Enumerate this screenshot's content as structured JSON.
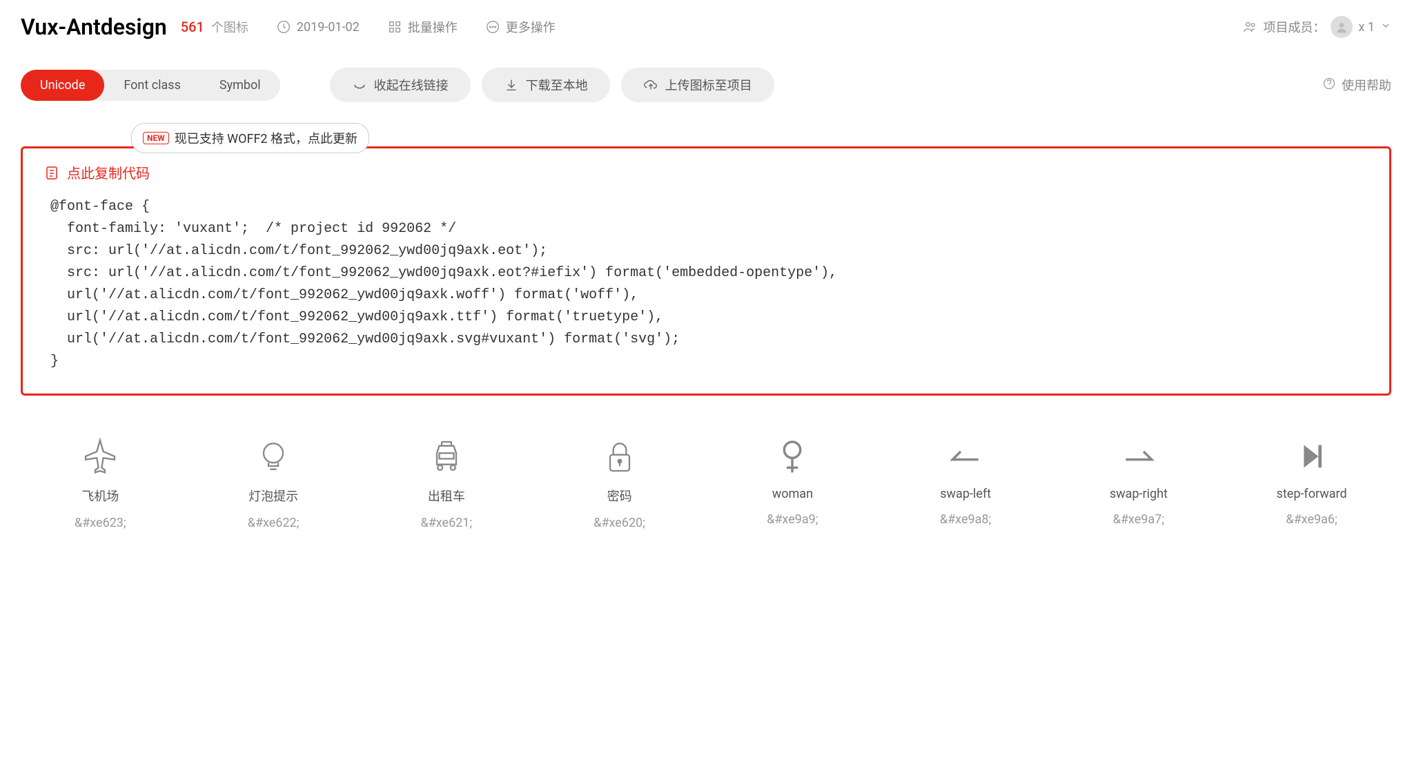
{
  "header": {
    "title": "Vux-Antdesign",
    "count": "561",
    "count_label": "个图标",
    "date": "2019-01-02",
    "batch": "批量操作",
    "more": "更多操作",
    "members_label": "项目成员：",
    "members_count": "x 1"
  },
  "tabs": {
    "unicode": "Unicode",
    "fontclass": "Font class",
    "symbol": "Symbol"
  },
  "actions": {
    "collapse": "收起在线链接",
    "download": "下载至本地",
    "upload": "上传图标至项目",
    "help": "使用帮助"
  },
  "banner": {
    "badge": "NEW",
    "text": "现已支持 WOFF2 格式，点此更新"
  },
  "copy_label": "点此复制代码",
  "code": "@font-face {\n  font-family: 'vuxant';  /* project id 992062 */\n  src: url('//at.alicdn.com/t/font_992062_ywd00jq9axk.eot');\n  src: url('//at.alicdn.com/t/font_992062_ywd00jq9axk.eot?#iefix') format('embedded-opentype'),\n  url('//at.alicdn.com/t/font_992062_ywd00jq9axk.woff') format('woff'),\n  url('//at.alicdn.com/t/font_992062_ywd00jq9axk.ttf') format('truetype'),\n  url('//at.alicdn.com/t/font_992062_ywd00jq9axk.svg#vuxant') format('svg');\n}",
  "icons": [
    {
      "name": "飞机场",
      "code": "&#xe623;"
    },
    {
      "name": "灯泡提示",
      "code": "&#xe622;"
    },
    {
      "name": "出租车",
      "code": "&#xe621;"
    },
    {
      "name": "密码",
      "code": "&#xe620;"
    },
    {
      "name": "woman",
      "code": "&#xe9a9;"
    },
    {
      "name": "swap-left",
      "code": "&#xe9a8;"
    },
    {
      "name": "swap-right",
      "code": "&#xe9a7;"
    },
    {
      "name": "step-forward",
      "code": "&#xe9a6;"
    }
  ]
}
